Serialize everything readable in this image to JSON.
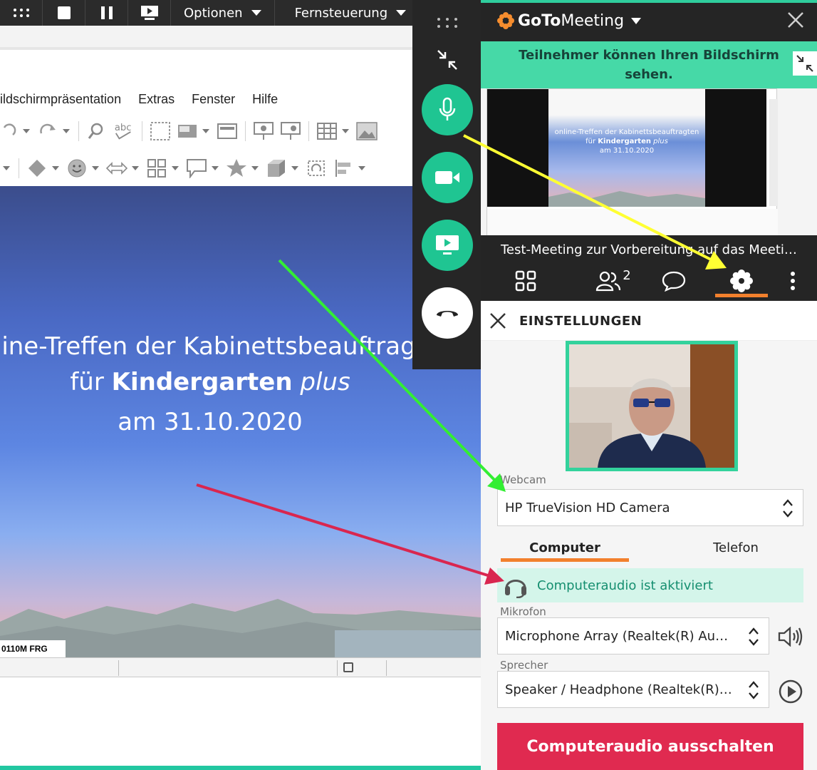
{
  "remote_toolbar": {
    "options_label": "Optionen",
    "remote_label": "Fernsteuerung"
  },
  "impress": {
    "menu": [
      "ildschirmpräsentation",
      "Extras",
      "Fenster",
      "Hilfe"
    ],
    "slide": {
      "title": "online-Treffen der Kabinettsbeauftragten",
      "subtitle_pre": "für ",
      "subtitle_bold": "Kindergarten",
      "subtitle_italic": "plus",
      "date": "am 31.10.2020",
      "badge": "0110M FRG"
    }
  },
  "gotomeeting": {
    "logo_goto": "GoTo",
    "logo_meeting": "Meeting",
    "share_notice": "Teilnehmer können Ihren Bildschirm sehen.",
    "mini_slide": {
      "line1": "online-Treffen der Kabinettsbeauftragten",
      "line2_pre": "für ",
      "line2_bold": "Kindergarten",
      "line2_italic": " plus",
      "line3": "am 31.10.2020"
    },
    "meeting_title": "Test-Meeting zur Vorbereitung auf das Meeti…",
    "nav": {
      "attendees_count": "2"
    },
    "settings": {
      "title": "EINSTELLUNGEN",
      "webcam_label": "Webcam",
      "webcam_value": "HP TrueVision HD Camera",
      "tabs": [
        "Computer",
        "Telefon"
      ],
      "audio_status": "Computeraudio ist aktiviert",
      "mic_label": "Mikrofon",
      "mic_value": "Microphone  Array  (Realtek(R)  Au…",
      "speaker_label": "Sprecher",
      "speaker_value": "Speaker  /  Headphone  (Realtek(R)…",
      "audio_off_button": "Computeraudio ausschalten"
    }
  },
  "colors": {
    "accent_green": "#1fc592",
    "accent_orange": "#f2802d",
    "danger_red": "#e02a50",
    "dark_bg": "#252525",
    "arrow_yellow": "#ffff33",
    "arrow_green": "#33ee33",
    "arrow_red": "#d9264f"
  },
  "icons": {
    "grid_menu": "grid-dots-icon",
    "stop": "stop-icon",
    "pause": "pause-icon",
    "present": "present-screen-icon",
    "collapse": "collapse-arrows-icon",
    "mic": "microphone-icon",
    "camera": "video-camera-icon",
    "screen": "screen-share-icon",
    "hangup": "hangup-phone-icon",
    "close": "close-icon",
    "layout": "grid-layout-icon",
    "people": "people-icon",
    "chat": "chat-bubble-icon",
    "settings": "gear-icon",
    "more": "more-vertical-icon",
    "headset": "headset-icon",
    "volume": "volume-icon",
    "play": "play-circle-icon",
    "updown": "up-down-chevrons-icon"
  }
}
